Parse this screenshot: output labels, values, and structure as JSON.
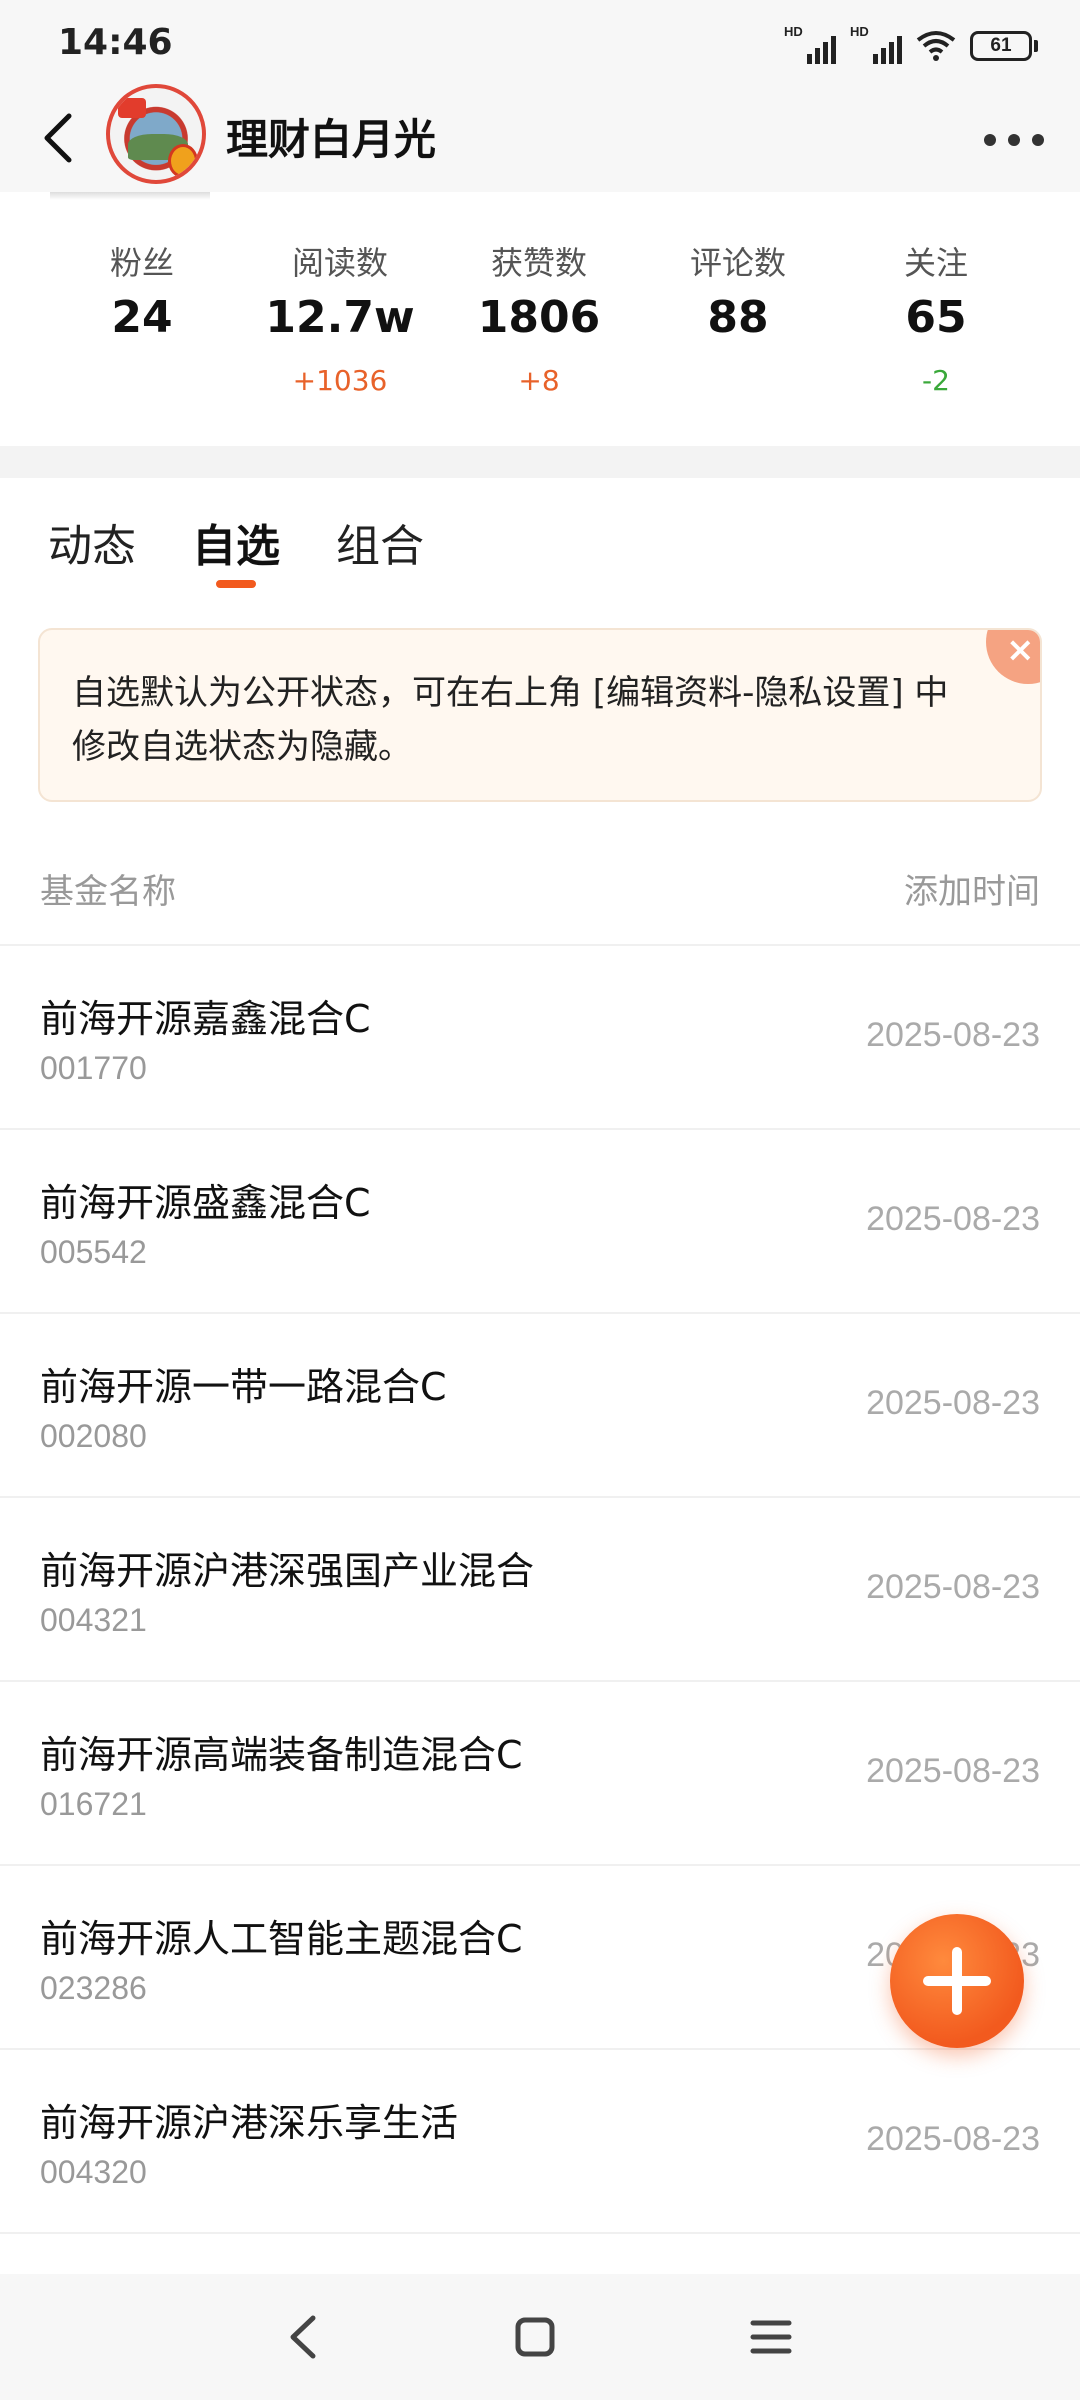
{
  "status_bar": {
    "time": "14:46",
    "signal_label": "HD",
    "battery": "61",
    "icons": [
      "hd-signal-icon",
      "hd-signal-icon",
      "wifi-icon",
      "battery-icon"
    ]
  },
  "header": {
    "title": "理财白月光",
    "back_icon": "chevron-left-icon",
    "more_icon": "more-dots-icon"
  },
  "stats": [
    {
      "label": "粉丝",
      "value": "24",
      "delta": ""
    },
    {
      "label": "阅读数",
      "value": "12.7w",
      "delta": "+1036",
      "delta_color": "#e8622a"
    },
    {
      "label": "获赞数",
      "value": "1806",
      "delta": "+8",
      "delta_color": "#e8622a"
    },
    {
      "label": "评论数",
      "value": "88",
      "delta": ""
    },
    {
      "label": "关注",
      "value": "65",
      "delta": "-2",
      "delta_color": "#3aa83a"
    }
  ],
  "tabs": [
    {
      "label": "动态",
      "active": false
    },
    {
      "label": "自选",
      "active": true
    },
    {
      "label": "组合",
      "active": false
    }
  ],
  "notice": {
    "text": "自选默认为公开状态，可在右上角 [编辑资料-隐私设置] 中修改自选状态为隐藏。",
    "close_icon": "close-icon"
  },
  "list": {
    "header_left": "基金名称",
    "header_right": "添加时间",
    "rows": [
      {
        "name": "前海开源嘉鑫混合C",
        "code": "001770",
        "date": "2025-08-23"
      },
      {
        "name": "前海开源盛鑫混合C",
        "code": "005542",
        "date": "2025-08-23"
      },
      {
        "name": "前海开源一带一路混合C",
        "code": "002080",
        "date": "2025-08-23"
      },
      {
        "name": "前海开源沪港深强国产业混合",
        "code": "004321",
        "date": "2025-08-23"
      },
      {
        "name": "前海开源高端装备制造混合C",
        "code": "016721",
        "date": "2025-08-23"
      },
      {
        "name": "前海开源人工智能主题混合C",
        "code": "023286",
        "date": "2025-08-23"
      },
      {
        "name": "前海开源沪港深乐享生活",
        "code": "004320",
        "date": "2025-08-23"
      }
    ]
  },
  "fab": {
    "icon": "plus-icon"
  },
  "colors": {
    "accent": "#f25a1e",
    "up": "#e8622a",
    "down": "#3aa83a"
  },
  "system_nav": {
    "icons": [
      "back-triangle-icon",
      "home-square-icon",
      "menu-lines-icon"
    ]
  }
}
